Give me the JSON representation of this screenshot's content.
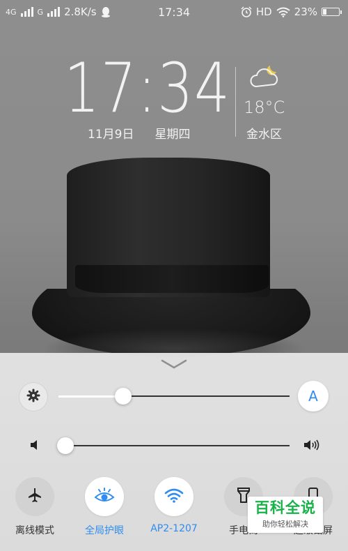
{
  "status_bar": {
    "network_left": "4G",
    "network_right": "G",
    "speed": "2.8K/s",
    "time": "17:34",
    "hd": "HD",
    "battery": "23%",
    "battery_level": 0.23
  },
  "clock": {
    "time": "17:34",
    "date": "11月9日",
    "weekday": "星期四"
  },
  "weather": {
    "temperature": "18°C",
    "location": "金水区",
    "icon": "cloudy-night-icon"
  },
  "control_center": {
    "brightness_level": 0.28,
    "auto_brightness_label": "A",
    "volume_level": 0.0,
    "toggles": [
      {
        "label": "离线模式",
        "icon": "airplane-icon",
        "active": false
      },
      {
        "label": "全局护眼",
        "icon": "eye-icon",
        "active": true
      },
      {
        "label": "AP2-1207",
        "icon": "wifi-icon",
        "active": true
      },
      {
        "label": "手电筒",
        "icon": "flashlight-icon",
        "active": false
      },
      {
        "label": "超级截屏",
        "icon": "screenshot-icon",
        "active": false
      }
    ]
  },
  "watermark": {
    "title": "百科全说",
    "subtitle": "助你轻松解决"
  }
}
